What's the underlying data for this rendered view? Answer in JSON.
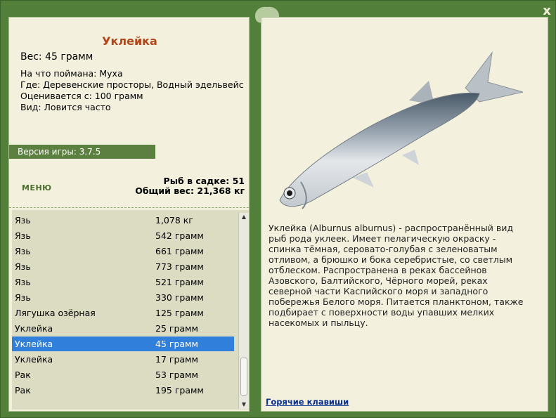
{
  "fish": {
    "name": "Уклейка",
    "weight_line": "Вес: 45 грамм",
    "caught_on": "На что поймана: Муха",
    "location": "Где: Деревенские просторы, Водный эдельвейс",
    "valued_from": "Оценивается с: 100 грамм",
    "frequency": "Вид: Ловится часто"
  },
  "version": "Версия игры: 3.7.5",
  "menu_label": "МЕНЮ",
  "stats": {
    "count_line": "Рыб в садке: 51",
    "total_line": "Общий вес: 21,368 кг"
  },
  "catch_list": [
    {
      "name": "Язь",
      "weight": "1,078 кг"
    },
    {
      "name": "Язь",
      "weight": "542 грамм"
    },
    {
      "name": "Язь",
      "weight": "661 грамм"
    },
    {
      "name": "Язь",
      "weight": "773 грамм"
    },
    {
      "name": "Язь",
      "weight": "521 грамм"
    },
    {
      "name": "Язь",
      "weight": "330 грамм"
    },
    {
      "name": "Лягушка озёрная",
      "weight": "125 грамм"
    },
    {
      "name": "Уклейка",
      "weight": "25 грамм"
    },
    {
      "name": "Уклейка",
      "weight": "45 грамм",
      "selected": true
    },
    {
      "name": "Уклейка",
      "weight": "17 грамм"
    },
    {
      "name": "Рак",
      "weight": "53 грамм"
    },
    {
      "name": "Рак",
      "weight": "195 грамм"
    }
  ],
  "description": "Уклейка (Alburnus alburnus) - распространённый вид рыб рода уклеек. Имеет пелагическую окраску - спинка тёмная, серовато-голубая с зеленоватым отливом, а брюшко и бока серебристые, со светлым отблеском. Распространена в реках бассейнов Азовского, Балтийского, Чёрного морей, реках северной части Каспийского моря и западного побережья Белого моря. Питается планктоном, также подбирает с поверхности воды упавших мелких насекомых и пыльцу.",
  "hotkeys_label": "Горячие клавиши",
  "close_label": "x",
  "colors": {
    "frame": "#52803a",
    "panel": "#f3f1dd",
    "title": "#b0461a",
    "selection": "#2f7fdb",
    "link": "#0a2f8f"
  }
}
